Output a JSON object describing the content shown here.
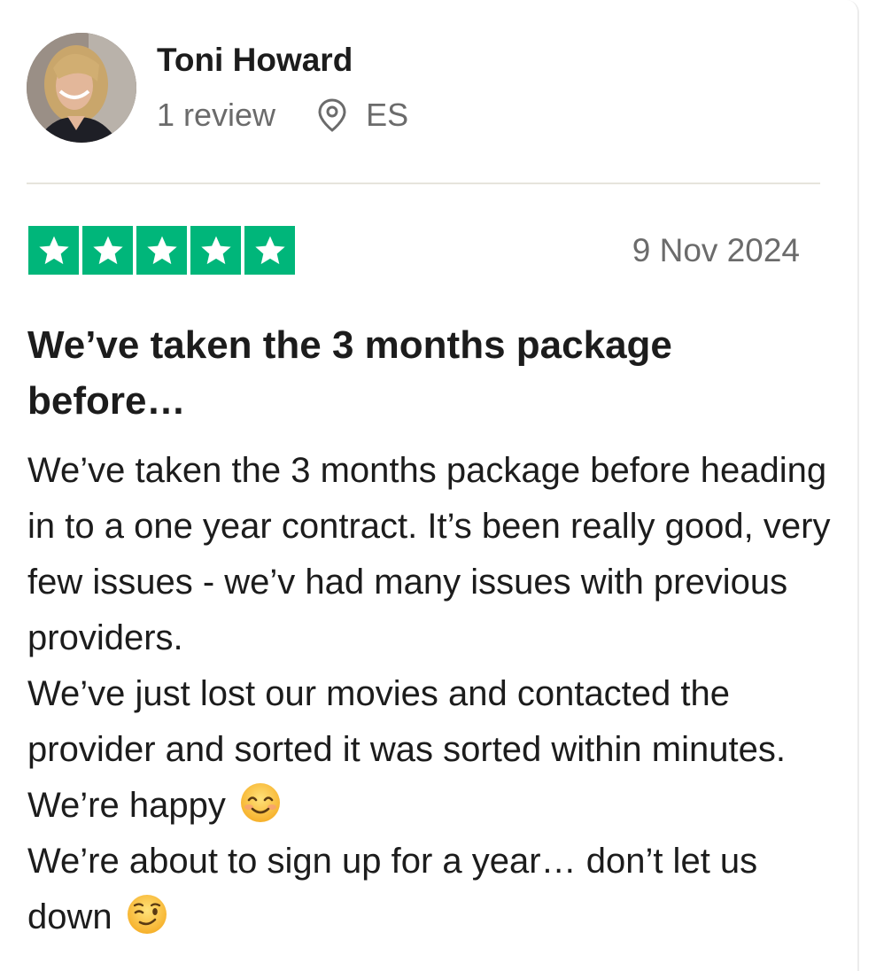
{
  "reviewer": {
    "name": "Toni Howard",
    "review_count": "1 review",
    "country": "ES"
  },
  "review": {
    "rating": 5,
    "rating_max": 5,
    "date": "9 Nov 2024",
    "title": "We’ve taken the 3 months package before…",
    "body_lines": [
      "We’ve taken the 3 months package before heading in to a one year contract. It’s been really good, very few issues - we’v had many issues with previous providers.",
      "We’ve just lost our movies and contacted the provider and sorted it was sorted within minutes. We’re happy",
      "We’re about to sign up for a year… don’t let us down"
    ]
  },
  "icons": {
    "avatar": "reviewer-photo",
    "location": "location-pin-icon",
    "star": "star-icon",
    "emoji_1": "smiling-face-icon",
    "emoji_2": "winking-face-icon"
  },
  "colors": {
    "star_green": "#00b67a",
    "text_primary": "#1c1c1c",
    "text_secondary": "#6b6b6b",
    "divider": "#e6e4dc"
  }
}
